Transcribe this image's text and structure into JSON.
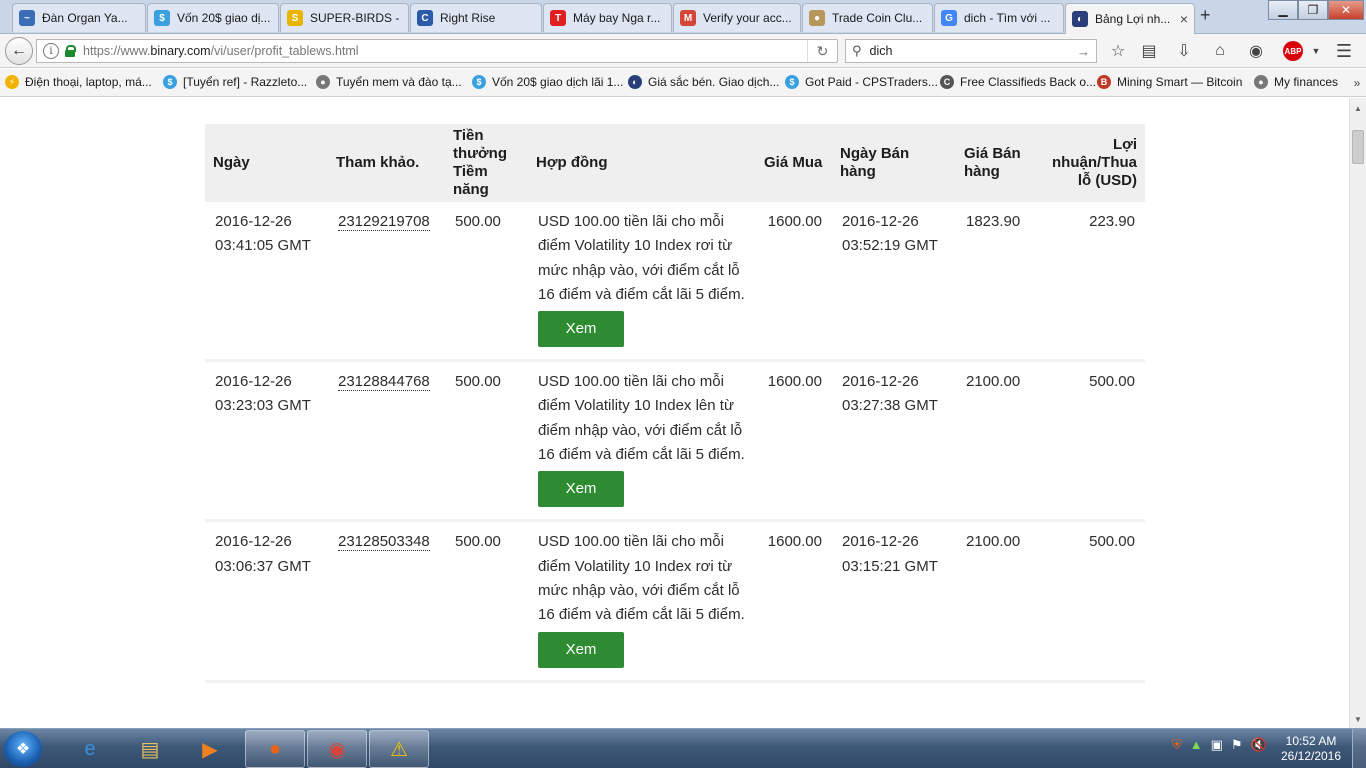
{
  "browser": {
    "tabs": [
      {
        "label": "Đàn Organ Ya...",
        "icon": "site-icon",
        "color": "#3a6db5",
        "glyph": "~"
      },
      {
        "label": "Vốn 20$ giao dị...",
        "icon": "dollar-circle-icon",
        "color": "#3aa0e0",
        "glyph": "$"
      },
      {
        "label": "SUPER-BIRDS - ...",
        "icon": "coin-icon",
        "color": "#e8b400",
        "glyph": "S"
      },
      {
        "label": "Right Rise",
        "icon": "rightrise-icon",
        "color": "#2a5aa8",
        "glyph": "C"
      },
      {
        "label": "Máy bay Nga r...",
        "icon": "t-icon",
        "color": "#e02020",
        "glyph": "T"
      },
      {
        "label": "Verify your acc...",
        "icon": "gmail-icon",
        "color": "#d44638",
        "glyph": "M"
      },
      {
        "label": "Trade Coin Clu...",
        "icon": "coin-icon",
        "color": "#b8985a",
        "glyph": "●"
      },
      {
        "label": "dich - Tìm với ...",
        "icon": "google-icon",
        "color": "#4285f4",
        "glyph": "G"
      },
      {
        "label": "Bảng Lợi nh...",
        "icon": "binary-icon",
        "color": "#2a3f7a",
        "glyph": "◐",
        "active": true
      }
    ],
    "new_tab_label": "+",
    "window_controls": {
      "minimize": "▁",
      "maximize": "❐",
      "close": "✕"
    },
    "url": {
      "prefix": "https://www.",
      "domain": "binary.com",
      "path": "/vi/user/profit_tablews.html"
    },
    "search_query": "dich",
    "bookmarks": [
      {
        "label": "Điện thoại, laptop, má...",
        "color": "#f0b400",
        "glyph": "⚡"
      },
      {
        "label": "[Tuyển ref] - Razzleto...",
        "color": "#3aa0e0",
        "glyph": "$"
      },
      {
        "label": "Tuyển mem và đào tạ...",
        "color": "#777777",
        "glyph": "●"
      },
      {
        "label": "Vốn 20$ giao dịch lãi 1...",
        "color": "#3aa0e0",
        "glyph": "$"
      },
      {
        "label": "Giá sắc bén. Giao dịch...",
        "color": "#2a3f7a",
        "glyph": "◐"
      },
      {
        "label": "Got Paid - CPSTraders...",
        "color": "#3aa0e0",
        "glyph": "$"
      },
      {
        "label": "Free Classifieds Back o...",
        "color": "#555555",
        "glyph": "C"
      },
      {
        "label": "Mining Smart — Bitcoin",
        "color": "#c0392b",
        "glyph": "B"
      },
      {
        "label": "My finances",
        "color": "#777777",
        "glyph": "●"
      }
    ]
  },
  "table": {
    "headers": {
      "date": "Ngày",
      "ref": "Tham khảo.",
      "payout": "Tiền thưởng Tiềm năng",
      "contract": "Hợp đồng",
      "buy_price": "Giá Mua",
      "sell_date": "Ngày Bán hàng",
      "sell_price": "Giá Bán hàng",
      "pl": "Lợi nhuận/Thua lỗ (USD)"
    },
    "view_button": "Xem",
    "rows": [
      {
        "date": "2016-12-26",
        "time": "03:41:05 GMT",
        "ref": "23129219708",
        "payout": "500.00",
        "contract": "USD 100.00 tiền lãi cho mỗi điểm Volatility 10 Index rơi từ mức nhập vào, với điểm cắt lỗ 16 điểm và điểm cắt lãi 5 điểm.",
        "buy_price": "1600.00",
        "sell_date": "2016-12-26",
        "sell_time": "03:52:19 GMT",
        "sell_price": "1823.90",
        "pl": "223.90"
      },
      {
        "date": "2016-12-26",
        "time": "03:23:03 GMT",
        "ref": "23128844768",
        "payout": "500.00",
        "contract": "USD 100.00 tiền lãi cho mỗi điểm Volatility 10 Index lên từ điểm nhập vào, với điểm cắt lỗ 16 điểm và điểm cắt lãi 5 điểm.",
        "buy_price": "1600.00",
        "sell_date": "2016-12-26",
        "sell_time": "03:27:38 GMT",
        "sell_price": "2100.00",
        "pl": "500.00"
      },
      {
        "date": "2016-12-26",
        "time": "03:06:37 GMT",
        "ref": "23128503348",
        "payout": "500.00",
        "contract": "USD 100.00 tiền lãi cho mỗi điểm Volatility 10 Index rơi từ mức nhập vào, với điểm cắt lỗ 16 điểm và điểm cắt lãi 5 điểm.",
        "buy_price": "1600.00",
        "sell_date": "2016-12-26",
        "sell_time": "03:15:21 GMT",
        "sell_price": "2100.00",
        "pl": "500.00"
      }
    ]
  },
  "taskbar": {
    "start_icon": "windows-start-icon",
    "apps": [
      {
        "name": "internet-explorer-icon",
        "glyph": "e",
        "color": "#3a8fe0",
        "open": false
      },
      {
        "name": "file-explorer-icon",
        "glyph": "▤",
        "color": "#e8c060",
        "open": false
      },
      {
        "name": "media-player-icon",
        "glyph": "▶",
        "color": "#f08020",
        "open": false
      },
      {
        "name": "firefox-icon",
        "glyph": "●",
        "color": "#e8641b",
        "open": true
      },
      {
        "name": "chrome-icon",
        "glyph": "◉",
        "color": "#db4437",
        "open": true
      },
      {
        "name": "warning-icon",
        "glyph": "⚠",
        "color": "#f2c200",
        "open": true
      }
    ],
    "clock_time": "10:52 AM",
    "clock_date": "26/12/2016"
  }
}
